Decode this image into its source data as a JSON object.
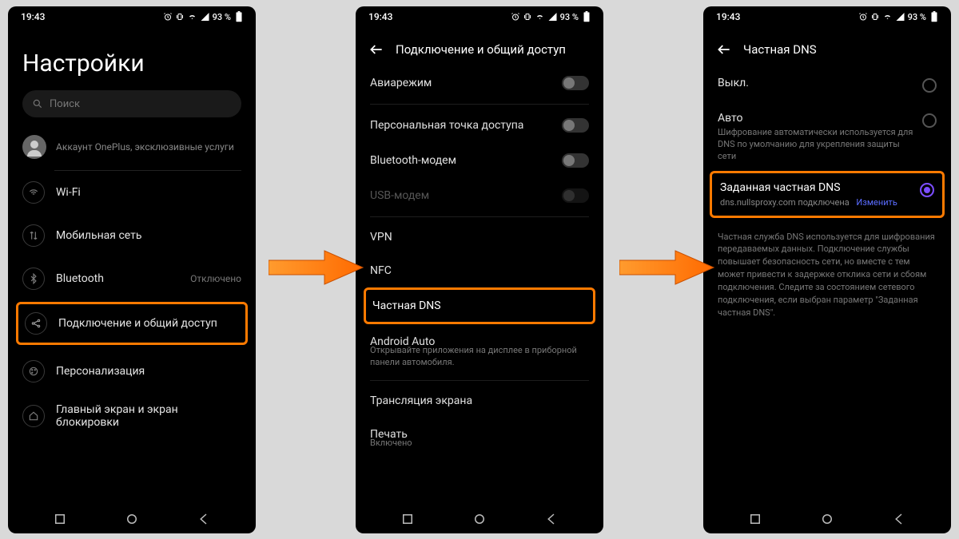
{
  "status": {
    "time": "19:43",
    "battery": "93 %"
  },
  "screen1": {
    "title": "Настройки",
    "search_placeholder": "Поиск",
    "account": "Аккаунт OnePlus, эксклюзивные услуги",
    "items": [
      {
        "label": "Wi-Fi"
      },
      {
        "label": "Мобильная сеть"
      },
      {
        "label": "Bluetooth",
        "trail": "Отключено"
      }
    ],
    "highlight_label": "Подключение и общий доступ",
    "more": [
      {
        "label": "Персонализация"
      },
      {
        "label": "Главный экран и экран блокировки"
      }
    ]
  },
  "screen2": {
    "header": "Подключение и общий доступ",
    "rows": [
      {
        "label": "Авиарежим",
        "toggle": true
      },
      {
        "label": "Персональная точка доступа",
        "toggle": true
      },
      {
        "label": "Bluetooth-модем",
        "toggle": true
      },
      {
        "label": "USB-модем",
        "toggle": true,
        "dim": true
      }
    ],
    "rows2": [
      {
        "label": "VPN"
      },
      {
        "label": "NFC"
      }
    ],
    "highlight_label": "Частная DNS",
    "rows3": {
      "android_auto": "Android Auto",
      "android_auto_sub": "Открывайте приложения на дисплее в приборной панели автомобиля.",
      "cast": "Трансляция экрана",
      "print": "Печать",
      "print_sub": "Включено"
    }
  },
  "screen3": {
    "header": "Частная DNS",
    "off": "Выкл.",
    "auto": {
      "title": "Авто",
      "desc": "Шифрование автоматически используется для DNS по умолчанию для укрепления защиты сети"
    },
    "custom": {
      "title": "Заданная частная DNS",
      "desc": "dns.nullsproxy.com подключена",
      "link": "Изменить"
    },
    "footnote": "Частная служба DNS используется для шифрования передаваемых данных. Подключение службы повышает безопасность сети, но вместе с тем может привести к задержке отклика сети и сбоям подключения. Следите за состоянием сетевого подключения, если выбран параметр \"Заданная частная DNS\"."
  }
}
